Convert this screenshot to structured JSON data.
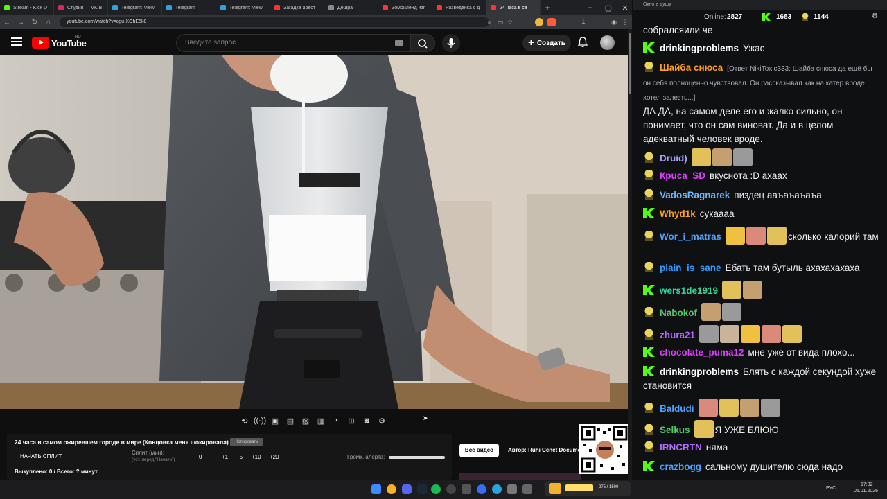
{
  "browser": {
    "tabs": [
      {
        "label": "Stream - Kick D",
        "color": "#53fc18"
      },
      {
        "label": "Студия — VK В",
        "color": "#e0245e"
      },
      {
        "label": "Telegram: View",
        "color": "#2aa3e0"
      },
      {
        "label": "Telegram",
        "color": "#2aa3e0"
      },
      {
        "label": "Telegram: View",
        "color": "#2aa3e0"
      },
      {
        "label": "Загадка арест",
        "color": "#ff3333"
      },
      {
        "label": "Дешра",
        "color": "#8a8a8a"
      },
      {
        "label": "Зомбиленд изг",
        "color": "#ff3333"
      },
      {
        "label": "Разведенка с д",
        "color": "#ff3333"
      },
      {
        "label": "24 часа в са",
        "color": "#ff3333"
      }
    ],
    "url": "youtube.com/watch?v=cgu-XOhE5k8"
  },
  "youtube": {
    "wordmark": "YouTube",
    "country": "RU",
    "search_placeholder": "Введите запрос",
    "create_label": "Создать"
  },
  "video_info": {
    "title": "24 часа в самом ожиревшем городе в мире (Концовка меня шокировала)",
    "copy_label": "Копировать",
    "start_split": "НАЧАТЬ СПЛИТ",
    "split_label": "Сплит (мин):",
    "split_hint": "(уст. перед \"Начать\")",
    "split_value": "0",
    "increments": [
      "+1",
      "+5",
      "+10",
      "+20"
    ],
    "alert_volume_label": "Громк. алерта:",
    "alert_volume": 1.0,
    "bought": "Выкуплено: 0 / Всего: ? минут",
    "all_videos": "Все видео",
    "author": "Автор: Ruhi Cenet Documentaries"
  },
  "chat": {
    "window_title": "Окно в душу",
    "online_label": "Online:",
    "online_count": "2827",
    "kick_count": "1683",
    "other_count": "1144",
    "messages": [
      {
        "user": "",
        "badge": "none",
        "text": "собралсяили че",
        "emotes": 0
      },
      {
        "user": "drinkingproblems",
        "badge": "kick",
        "color": "#ffffff",
        "text": "Ужас",
        "emotes": 0
      },
      {
        "user": "Шайба снюса",
        "badge": "bot",
        "color": "#ff9f1c",
        "reply": "[Ответ NikiToxic333: Шайба снюса да ещё бы он себя полноценно чувствовал. Он рассказывал как на катер вроде хотел залезть...]",
        "text": "ДА ДА, на самом деле его и жалко сильно, он понимает, что он сам виноват. Да и в целом адекватный человек вроде.",
        "emotes": 0
      },
      {
        "user": "Druid)",
        "badge": "bot",
        "color": "#a7a4ff",
        "text": "",
        "emotes": 3
      },
      {
        "user": "Крuca_SD",
        "badge": "bot",
        "color": "#e03cff",
        "text": "вкуснота :D ахаах",
        "emotes": 0
      },
      {
        "user": "VadosRagnarek",
        "badge": "bot",
        "color": "#6cb6ff",
        "text": "пиздец ааъаъаъаъа",
        "emotes": 0
      },
      {
        "user": "Whyd1k",
        "badge": "kick",
        "color": "#ff9f1c",
        "text": "сукаааа",
        "emotes": 0
      },
      {
        "user": "Wor_i_matras",
        "badge": "bot",
        "color": "#4ea1ff",
        "text": "сколько калорий там",
        "emotes": 3
      },
      {
        "user": "plain_is_sane",
        "badge": "bot",
        "color": "#2f9cff",
        "text": "Ебать там бутыль ахахахахаха",
        "emotes": 0
      },
      {
        "user": "wers1de1919",
        "badge": "kick",
        "color": "#34d399",
        "text": "",
        "emotes": 2
      },
      {
        "user": "Nabokof",
        "badge": "bot",
        "color": "#53c96a",
        "text": "",
        "emotes": 2
      },
      {
        "user": "zhura21",
        "badge": "bot",
        "color": "#b36bff",
        "text": "",
        "emotes": 5
      },
      {
        "user": "chocolate_puma12",
        "badge": "kick",
        "color": "#e03cff",
        "text": "мне уже от вида плохо...",
        "emotes": 0
      },
      {
        "user": "drinkingproblems",
        "badge": "kick",
        "color": "#ffffff",
        "text": "Блять с каждой секундой хуже становится",
        "emotes": 0
      },
      {
        "user": "Baldudi",
        "badge": "bot",
        "color": "#4ea1ff",
        "text": "",
        "emotes": 4
      },
      {
        "user": "Selkus",
        "badge": "bot",
        "color": "#53c96a",
        "text": "Я УЖЕ БЛЮЮ",
        "emotes": 1
      },
      {
        "user": "IRNCRTN",
        "badge": "bot",
        "color": "#b36bff",
        "text": "няма",
        "emotes": 0
      },
      {
        "user": "crazbogg",
        "badge": "kick",
        "color": "#4ea1ff",
        "text": "сальному душителю сюда надо",
        "emotes": 0
      }
    ]
  },
  "taskbar": {
    "game_counter": "275 / 1500",
    "lang": "РУС",
    "time": "17:32",
    "date": "05.01.2026"
  },
  "colors": {
    "kick_green": "#53fc18",
    "youtube_red": "#ff0000"
  }
}
